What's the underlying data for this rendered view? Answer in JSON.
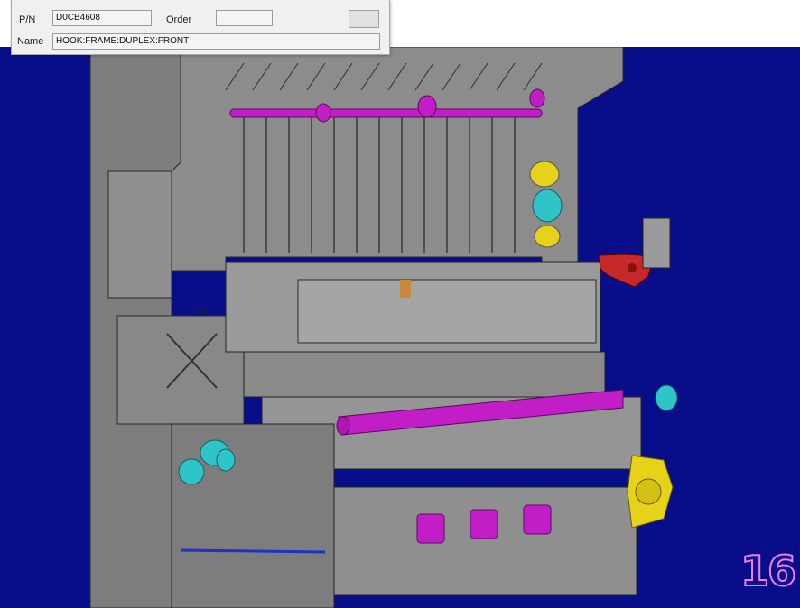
{
  "part_info": {
    "pn_label": "P/N",
    "pn_value": "D0CB4608",
    "order_label": "Order",
    "order_value": "",
    "name_label": "Name",
    "name_value": "HOOK:FRAME:DUPLEX:FRONT",
    "order_button_label": ""
  },
  "viewer": {
    "page_number": "16",
    "colors": {
      "background": "#080e8a",
      "frame": "#8a8a8a",
      "highlight_roller": "#c21ec8",
      "bearing_cyan": "#2fc4c8",
      "bearing_yellow": "#e6d21a",
      "selected_hook": "#c8282a"
    }
  }
}
